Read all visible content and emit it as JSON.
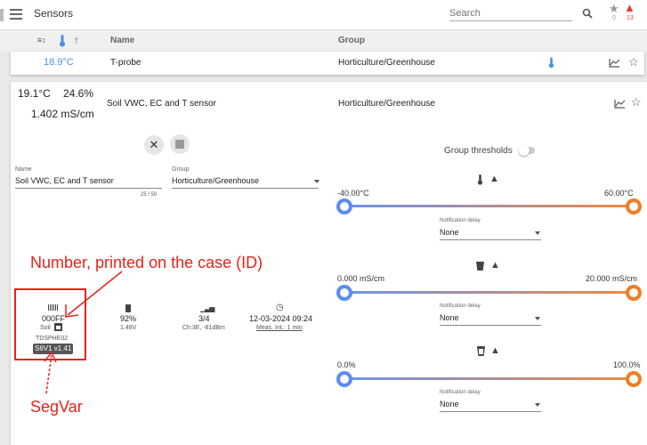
{
  "topbar": {
    "title": "Sensors",
    "search_placeholder": "Search",
    "favorites_count": "0",
    "alerts_count": "13"
  },
  "columns": {
    "name": "Name",
    "group": "Group"
  },
  "row_tprobe": {
    "temp": "18.9°C",
    "name": "T-probe",
    "group": "Horticulture/Greenhouse"
  },
  "sensor": {
    "temp": "19.1°C",
    "humidity": "24.6%",
    "ec": "1.402 mS/cm",
    "name": "Soil VWC, EC and T sensor",
    "group": "Horticulture/Greenhouse"
  },
  "form": {
    "name_label": "Name",
    "name_value": "Soil VWC, EC and T sensor",
    "name_counter": "25 / 50",
    "group_label": "Group",
    "group_value": "Horticulture/Greenhouse"
  },
  "thresholds": {
    "group_label": "Group thresholds",
    "group_enabled": false,
    "delay_label": "Notification delay",
    "temp": {
      "min": "-40.00°C",
      "max": "60.00°C",
      "delay": "None"
    },
    "ec": {
      "min": "0.000 mS/cm",
      "max": "20.000 mS/cm",
      "delay": "None"
    },
    "vwc": {
      "min": "0.0%",
      "max": "100.0%",
      "delay": "None"
    }
  },
  "device": {
    "id": "000FF",
    "type": "Soil",
    "model": "TDSPHE02",
    "segvar": "S6V1 v1.41",
    "battery_pct": "92%",
    "battery_v": "1.48V",
    "signal": "3/4",
    "signal_detail": "Ch:3E, -81dBm",
    "timestamp": "12-03-2024 09:24",
    "interval": "Meas. Int.: 1 min"
  },
  "annotations": {
    "id_note": "Number, printed on the case (ID)",
    "segvar_note": "SegVar"
  },
  "colors": {
    "accent_blue": "#4a90e2",
    "slider_start": "#5c8cf2",
    "slider_end": "#f07d26",
    "annotation_red": "#e8221a"
  }
}
